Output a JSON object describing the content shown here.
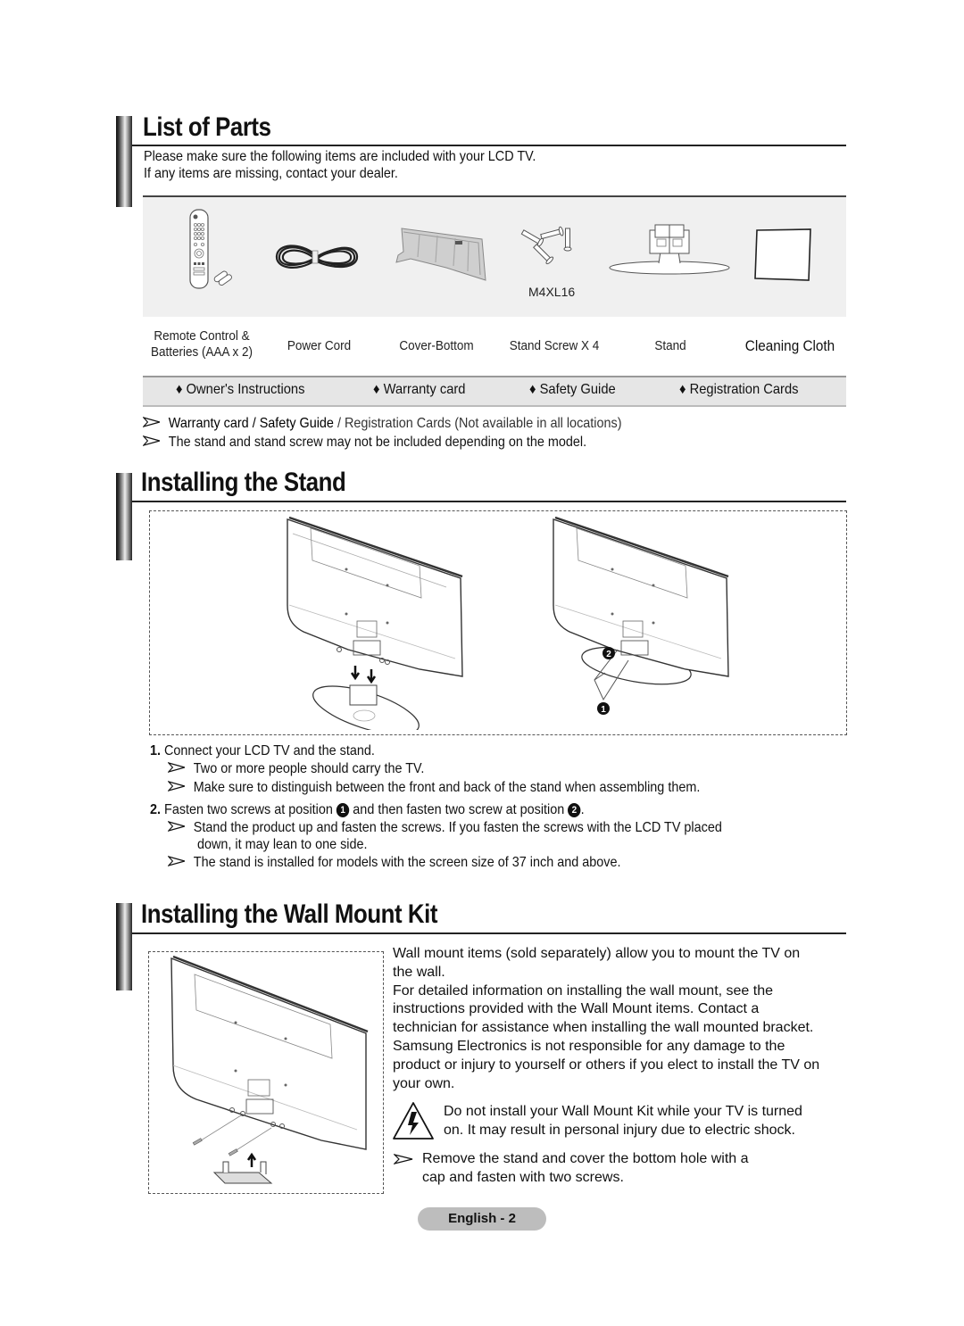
{
  "sections": {
    "list_of_parts": {
      "title": "List of Parts",
      "intro_line1": "Please make sure the following items are included with your LCD TV.",
      "intro_line2": "If any items are missing, contact your dealer.",
      "parts": [
        {
          "label_line1": "Remote Control &",
          "label_line2": "Batteries (AAA x 2)",
          "icon": "remote-control-icon"
        },
        {
          "label_line1": "Power Cord",
          "label_line2": "",
          "icon": "power-cord-icon"
        },
        {
          "label_line1": "Cover-Bottom",
          "label_line2": "",
          "icon": "cover-bottom-icon"
        },
        {
          "label_line1": "Stand Screw X 4",
          "label_line2": "",
          "icon": "stand-screw-icon",
          "caption": "M4XL16"
        },
        {
          "label_line1": "Stand",
          "label_line2": "",
          "icon": "stand-icon"
        },
        {
          "label_line1": "Cleaning Cloth",
          "label_line2": "",
          "icon": "cleaning-cloth-icon"
        }
      ],
      "extras": [
        "♦ Owner's Instructions",
        "♦ Warranty card",
        "♦ Safety Guide",
        "♦ Registration Cards"
      ],
      "notes": [
        {
          "bold_part": "Warranty card / Safety Guide",
          "rest": " / Registration Cards (Not available in all locations)"
        },
        {
          "bold_part": "",
          "rest": "The stand and stand screw may not be included depending on the model."
        }
      ]
    },
    "installing_stand": {
      "title": "Installing the Stand",
      "callout_1": "1",
      "callout_2": "2",
      "step1_num": "1.",
      "step1_text": "Connect your LCD TV and the stand.",
      "step1_notes": [
        "Two or more people should carry the TV.",
        "Make sure to distinguish between the front and back of the stand when assembling them."
      ],
      "step2_num": "2.",
      "step2_text_a": "Fasten two screws at position ",
      "step2_text_b": " and then fasten two screw at position ",
      "step2_text_c": ".",
      "step2_notes": [
        "Stand the product up and fasten the screws. If you fasten the screws with the LCD TV placed",
        "down, it may lean to one side.",
        "The stand is installed for models with the screen size of 37 inch and above."
      ]
    },
    "wall_mount": {
      "title": "Installing the Wall Mount Kit",
      "paragraph_lines": [
        "Wall mount items (sold separately) allow you to mount the TV on",
        "the wall.",
        "For detailed information on installing the wall mount, see the",
        "instructions provided with the Wall Mount items. Contact a",
        "technician for assistance when installing the wall mounted bracket.",
        "Samsung Electronics is not responsible for any damage to the",
        "product or injury to yourself or others if you elect to install the TV on",
        "your own."
      ],
      "warning_lines": [
        "Do not install your Wall Mount Kit while your TV is turned",
        "on. It may result in personal injury due to electric shock."
      ],
      "note_lines": [
        "Remove the stand and cover the bottom hole with a",
        "cap and fasten with two screws."
      ]
    }
  },
  "footer": {
    "page_label": "English - 2"
  }
}
